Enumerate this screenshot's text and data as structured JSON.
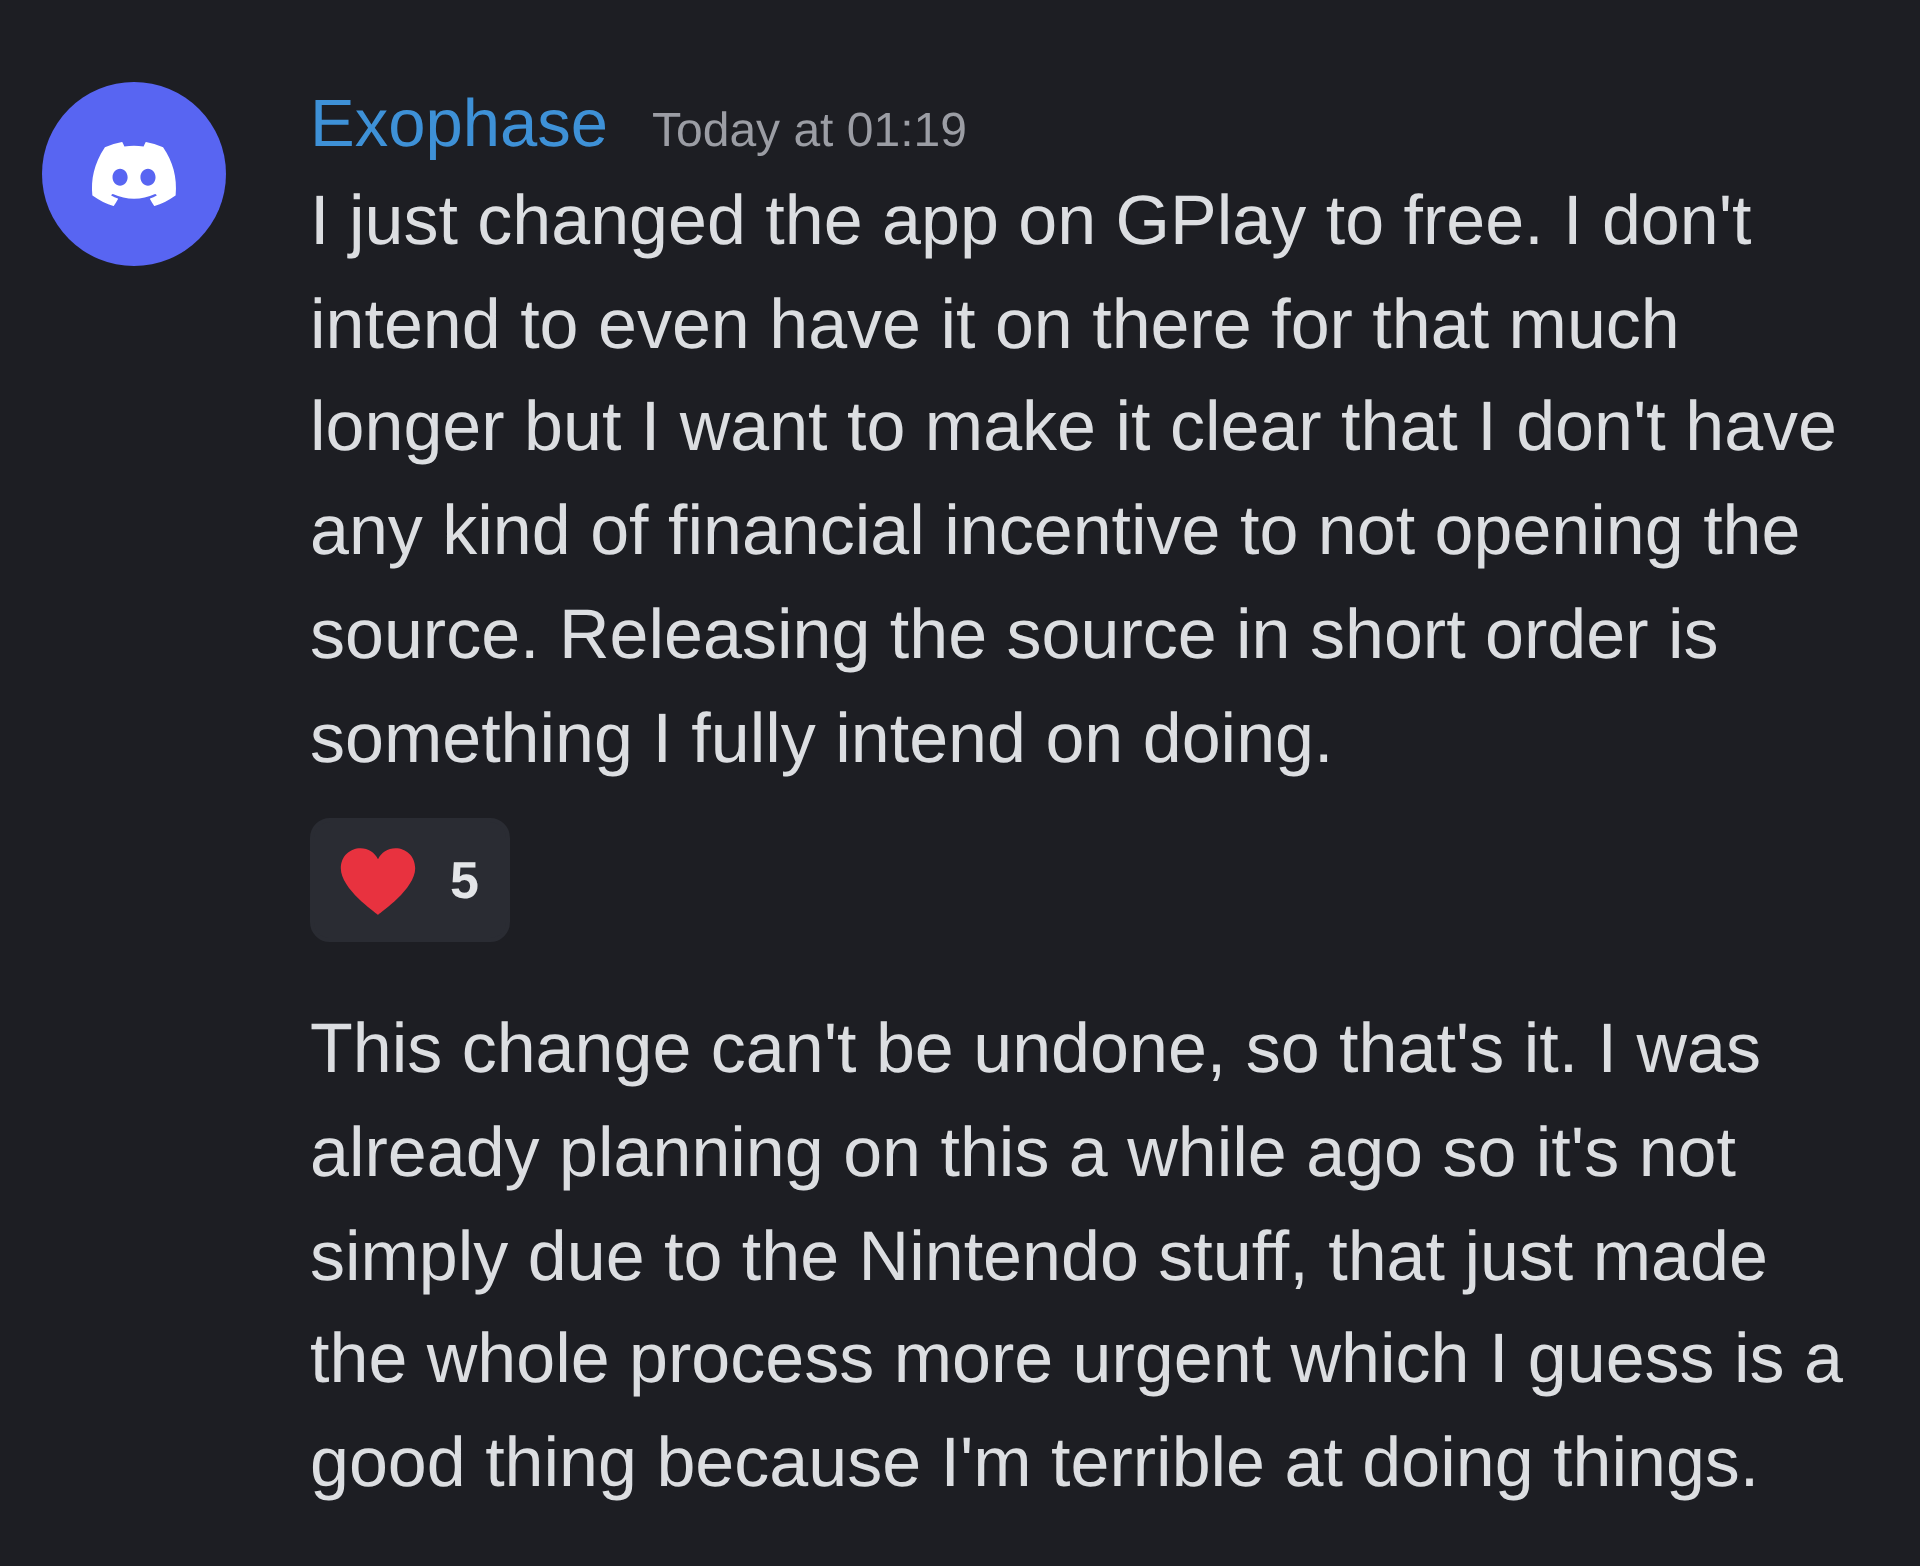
{
  "messages": [
    {
      "author": "Exophase",
      "timestamp": "Today at 01:19",
      "text": "I just changed the app on GPlay to free. I don't intend to even have it on there for that much longer but I want to make it clear that I don't have any kind of financial incentive to not opening the source. Releasing the source in short order is something I fully intend on doing.",
      "reactions": [
        {
          "count": "5",
          "selected": false
        }
      ]
    },
    {
      "text": "This change can't be undone, so that's it. I was already planning on this a while ago so it's not simply due to the Nintendo stuff, that just made the whole process more urgent which I guess is a good thing because I'm terrible at doing things."
    }
  ]
}
